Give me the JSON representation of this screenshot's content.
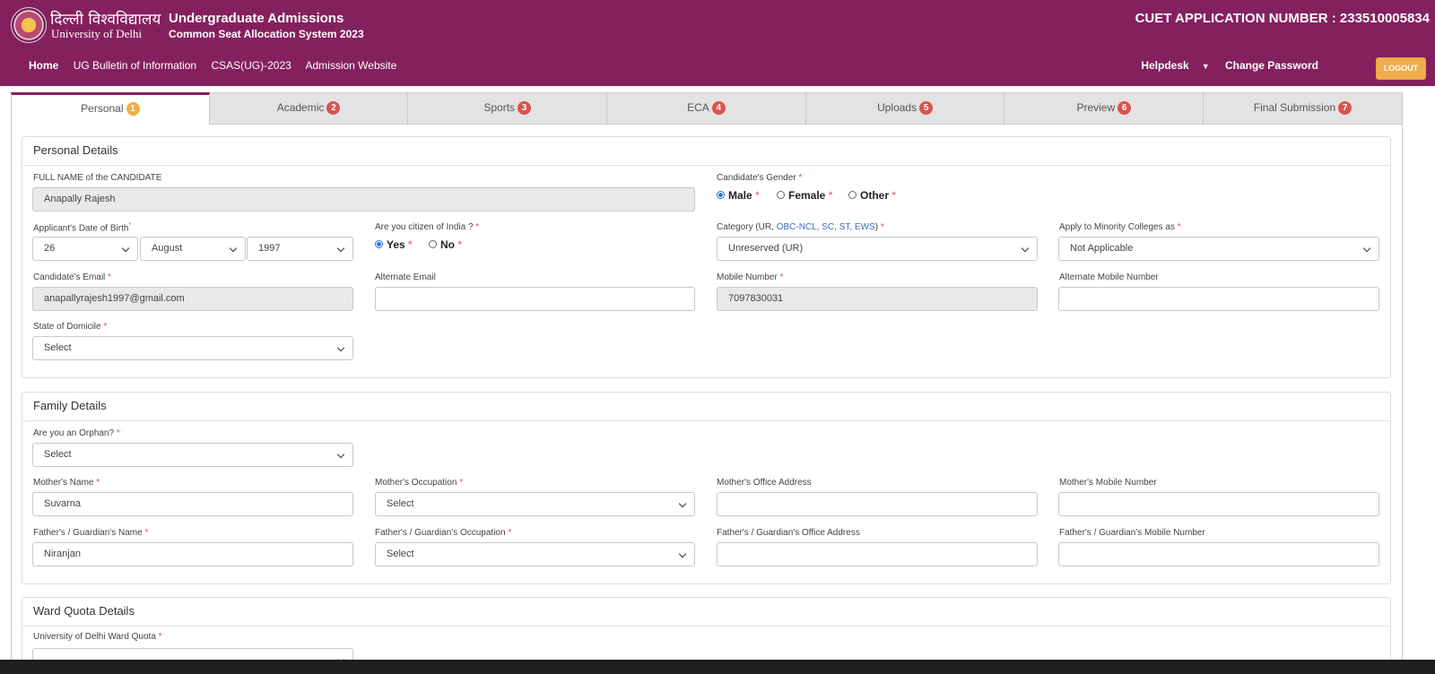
{
  "header": {
    "uni_hindi": "दिल्ली विश्वविद्यालय",
    "uni_english": "University of Delhi",
    "title": "Undergraduate Admissions",
    "subtitle": "Common Seat Allocation System 2023",
    "application_number": "CUET APPLICATION NUMBER : 233510005834",
    "logo_icon": "university-seal-icon",
    "colors": {
      "brand": "#85205f",
      "logout": "#f0ad4e",
      "badge": "#d9534f"
    }
  },
  "nav": {
    "home": "Home",
    "bulletin": "UG Bulletin of Information",
    "csas": "CSAS(UG)-2023",
    "admission_website": "Admission Website",
    "helpdesk": "Helpdesk",
    "change_password": "Change Password",
    "logout": "LOGOUT"
  },
  "tabs": [
    {
      "label": "Personal",
      "badge": "1"
    },
    {
      "label": "Academic",
      "badge": "2"
    },
    {
      "label": "Sports",
      "badge": "3"
    },
    {
      "label": "ECA",
      "badge": "4"
    },
    {
      "label": "Uploads",
      "badge": "5"
    },
    {
      "label": "Preview",
      "badge": "6"
    },
    {
      "label": "Final Submission",
      "badge": "7"
    }
  ],
  "personal": {
    "title": "Personal Details",
    "full_name_label": "FULL NAME of the CANDIDATE",
    "full_name_value": "Anapally Rajesh",
    "gender_label": "Candidate's Gender",
    "gender_options": [
      "Male",
      "Female",
      "Other"
    ],
    "gender_selected": "Male",
    "dob_label": "Applicant's Date of Birth",
    "dob_day": "26",
    "dob_month": "August",
    "dob_year": "1997",
    "citizen_label": "Are you citizen of India ?",
    "citizen_options": [
      "Yes",
      "No"
    ],
    "citizen_selected": "Yes",
    "category_label_prefix": "Category (UR, ",
    "category_label_links": "OBC-NCL, SC, ST, EWS",
    "category_label_suffix": ")",
    "category_value": "Unreserved (UR)",
    "minority_label": "Apply to Minority Colleges as",
    "minority_value": "Not Applicable",
    "email_label": "Candidate's Email",
    "email_value": "anapallyrajesh1997@gmail.com",
    "alt_email_label": "Alternate Email",
    "alt_email_value": "",
    "mobile_label": "Mobile Number",
    "mobile_value": "7097830031",
    "alt_mobile_label": "Alternate Mobile Number",
    "alt_mobile_value": "",
    "domicile_label": "State of Domicile",
    "domicile_value": "Select"
  },
  "family": {
    "title": "Family Details",
    "orphan_label": "Are you an Orphan?",
    "orphan_value": "Select",
    "mother_name_label": "Mother's Name",
    "mother_name_value": "Suvarna",
    "mother_occ_label": "Mother's Occupation",
    "mother_occ_value": "Select",
    "mother_office_label": "Mother's Office Address",
    "mother_office_value": "",
    "mother_mobile_label": "Mother's Mobile Number",
    "mother_mobile_value": "",
    "father_name_label": "Father's / Guardian's Name",
    "father_name_value": "Niranjan",
    "father_occ_label": "Father's / Guardian's Occupation",
    "father_occ_value": "Select",
    "father_office_label": "Father's / Guardian's Office Address",
    "father_office_value": "",
    "father_mobile_label": "Father's / Guardian's Mobile Number",
    "father_mobile_value": ""
  },
  "ward": {
    "title": "Ward Quota Details",
    "quota_label": "University of Delhi Ward Quota"
  },
  "required_mark": "*"
}
